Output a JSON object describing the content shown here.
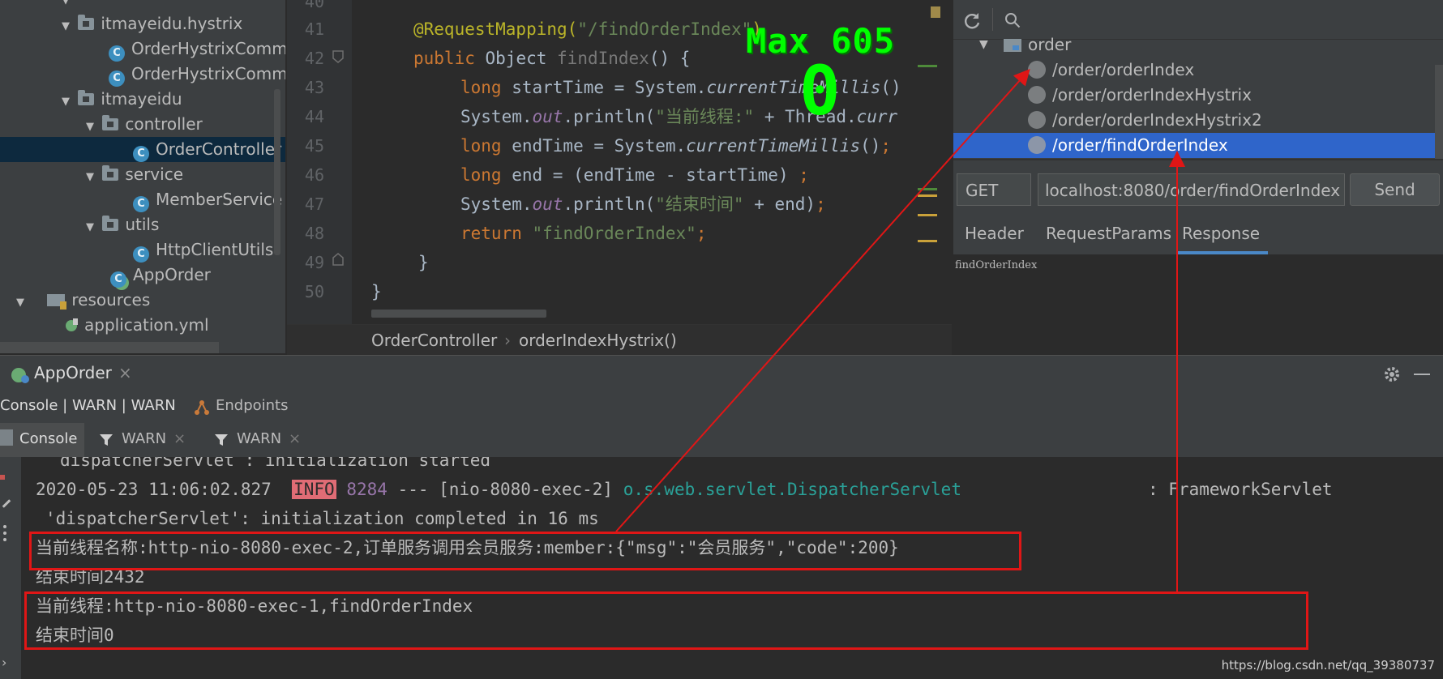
{
  "project_tree": {
    "items": [
      {
        "label": "itmayeidu.hystrix",
        "type": "package",
        "expanded": true
      },
      {
        "label": "OrderHystrixComma",
        "type": "class"
      },
      {
        "label": "OrderHystrixComma",
        "type": "class"
      },
      {
        "label": "itmayeidu",
        "type": "package",
        "expanded": true
      },
      {
        "label": "controller",
        "type": "package",
        "expanded": true
      },
      {
        "label": "OrderController",
        "type": "class",
        "selected": true
      },
      {
        "label": "service",
        "type": "package",
        "expanded": true
      },
      {
        "label": "MemberService",
        "type": "class"
      },
      {
        "label": "utils",
        "type": "package",
        "expanded": true
      },
      {
        "label": "HttpClientUtils",
        "type": "class"
      },
      {
        "label": "AppOrder",
        "type": "app-class"
      },
      {
        "label": "resources",
        "type": "resources",
        "expanded": true
      },
      {
        "label": "application.yml",
        "type": "yml"
      }
    ]
  },
  "editor": {
    "lines": [
      {
        "num": "41",
        "code": "@RequestMapping(\"/findOrderIndex\")"
      },
      {
        "num": "42",
        "code": "public Object findIndex() {"
      },
      {
        "num": "43",
        "code": "long startTime = System.currentTimeMillis();"
      },
      {
        "num": "44",
        "code": "System.out.println(\"当前线程:\" + Thread.curr"
      },
      {
        "num": "45",
        "code": "long endTime = System.currentTimeMillis();"
      },
      {
        "num": "46",
        "code": "long end = (endTime - startTime) ;"
      },
      {
        "num": "47",
        "code": "System.out.println(\"结束时间\" + end);"
      },
      {
        "num": "48",
        "code": "return \"findOrderIndex\";"
      },
      {
        "num": "49",
        "code": "}"
      },
      {
        "num": "50",
        "code": "}"
      }
    ],
    "tokens": {
      "l41_ann": "@RequestMapping(",
      "l41_str": "\"/findOrderIndex\"",
      "l41_close": ")",
      "l42_kw": "public ",
      "l42_rest": "Object ",
      "l42_name": "findIndex",
      "l42_tail": "() {",
      "l43_kw": "long ",
      "l43_a": "startTime = System.",
      "l43_m": "currentTimeMillis",
      "l43_b": "()",
      "l44_a": "System.",
      "l44_f": "out",
      "l44_b": ".println(",
      "l44_s": "\"当前线程:\"",
      "l44_c": " + Thread.",
      "l44_m": "curr",
      "l45_kw": "long ",
      "l45_a": "endTime = System.",
      "l45_m": "currentTimeMillis",
      "l45_b": "()",
      "l45_semi": ";",
      "l46_kw": "long ",
      "l46_a": "end = (endTime - startTime) ",
      "l46_semi": ";",
      "l47_a": "System.",
      "l47_f": "out",
      "l47_b": ".println(",
      "l47_s": "\"结束时间\"",
      "l47_c": " + end)",
      "l47_semi": ";",
      "l48_kw": "return ",
      "l48_s": "\"findOrderIndex\"",
      "l48_semi": ";",
      "l49": "}",
      "l50": "}"
    },
    "breadcrumb": {
      "class": "OrderController",
      "sep": "›",
      "method": "orderIndexHystrix()"
    },
    "overlay": {
      "max_text": "Max 605",
      "value_text": "0"
    }
  },
  "rest_panel": {
    "module": "order",
    "endpoints": [
      "/order/orderIndex",
      "/order/orderIndexHystrix",
      "/order/orderIndexHystrix2",
      "/order/findOrderIndex"
    ],
    "selected_endpoint": "/order/findOrderIndex",
    "method": "GET",
    "url": "localhost:8080/order/findOrderIndex",
    "send_label": "Send",
    "tabs": [
      "Header",
      "RequestParams",
      "Response"
    ],
    "active_tab": "Response",
    "response_body": "findOrderIndex"
  },
  "run_panel": {
    "app_tab": "AppOrder",
    "tab_close": "×",
    "console_group_tab": "Console | WARN | WARN",
    "endpoints_tab": "Endpoints",
    "subtabs": [
      "Console",
      "WARN",
      "WARN"
    ],
    "log": {
      "line0": "dispatcherServlet : initialization started",
      "line1_ts": "2020-05-23 11:06:02.827",
      "line1_level": "INFO",
      "line1_pid": "8284",
      "line1_thread": "--- [nio-8080-exec-2]",
      "line1_logger": "o.s.web.servlet.DispatcherServlet",
      "line1_msg": ": FrameworkServlet",
      "line2": "'dispatcherServlet': initialization completed in 16 ms",
      "line3": "当前线程名称:http-nio-8080-exec-2,订单服务调用会员服务:member:{\"msg\":\"会员服务\",\"code\":200}",
      "line4": "结束时间2432",
      "line5": "当前线程:http-nio-8080-exec-1,findOrderIndex",
      "line6": "结束时间0"
    }
  },
  "watermark": "https://blog.csdn.net/qq_39380737",
  "colors": {
    "highlight_box": "#e01616",
    "overlay_green": "#00ff00",
    "selection_blue": "#2f65ca"
  }
}
